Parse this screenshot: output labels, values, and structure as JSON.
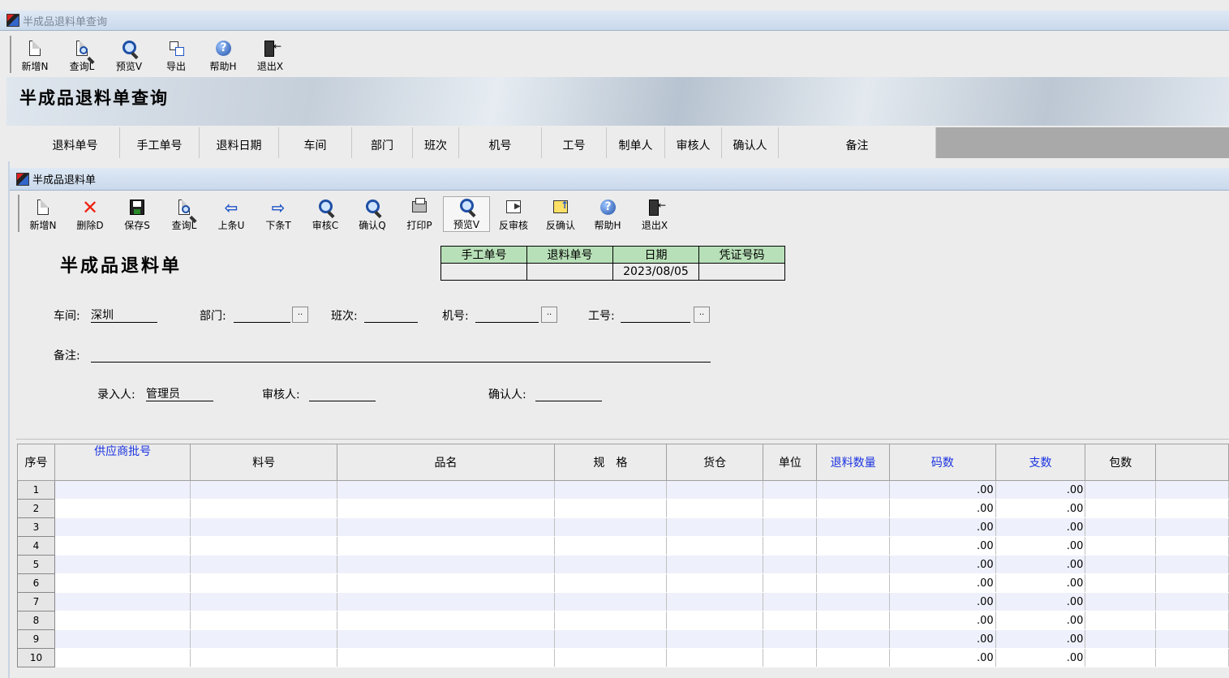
{
  "outer_window": {
    "title": "半成品退料单查询"
  },
  "outer_toolbar": [
    {
      "label": "新增N",
      "icon": "new-doc-icon",
      "kind": "doc"
    },
    {
      "label": "查询L",
      "icon": "query-icon",
      "kind": "docmag"
    },
    {
      "label": "预览V",
      "icon": "preview-icon",
      "kind": "mag"
    },
    {
      "label": "导出",
      "icon": "export-icon",
      "kind": "export"
    },
    {
      "label": "帮助H",
      "icon": "help-icon",
      "kind": "help"
    },
    {
      "label": "退出X",
      "icon": "exit-icon",
      "kind": "exit"
    }
  ],
  "banner": {
    "title": "半成品退料单查询"
  },
  "query_columns": [
    {
      "label": "退料单号",
      "w": 110
    },
    {
      "label": "手工单号",
      "w": 98
    },
    {
      "label": "退料日期",
      "w": 98
    },
    {
      "label": "车间",
      "w": 90
    },
    {
      "label": "部门",
      "w": 75
    },
    {
      "label": "班次",
      "w": 57
    },
    {
      "label": "机号",
      "w": 102
    },
    {
      "label": "工号",
      "w": 80
    },
    {
      "label": "制单人",
      "w": 72
    },
    {
      "label": "审核人",
      "w": 70
    },
    {
      "label": "确认人",
      "w": 70
    },
    {
      "label": "备注",
      "w": 194
    }
  ],
  "inner_window": {
    "title": "半成品退料单"
  },
  "inner_toolbar": [
    {
      "label": "新增N",
      "icon": "new-doc-icon",
      "kind": "doc"
    },
    {
      "label": "删除D",
      "icon": "delete-icon",
      "kind": "x"
    },
    {
      "label": "保存S",
      "icon": "save-icon",
      "kind": "save"
    },
    {
      "label": "查询L",
      "icon": "query-icon",
      "kind": "docmag"
    },
    {
      "label": "上条U",
      "icon": "prev-arrow-icon",
      "kind": "left"
    },
    {
      "label": "下条T",
      "icon": "next-arrow-icon",
      "kind": "right"
    },
    {
      "label": "审核C",
      "icon": "audit-icon",
      "kind": "mag"
    },
    {
      "label": "确认Q",
      "icon": "confirm-icon",
      "kind": "mag"
    },
    {
      "label": "打印P",
      "icon": "print-icon",
      "kind": "print"
    },
    {
      "label": "预览V",
      "icon": "preview-icon",
      "kind": "mag",
      "selected": true
    },
    {
      "label": "反审核",
      "icon": "unaudit-icon",
      "kind": "rev"
    },
    {
      "label": "反确认",
      "icon": "unconfirm-icon",
      "kind": "conf"
    },
    {
      "label": "帮助H",
      "icon": "help-icon",
      "kind": "help"
    },
    {
      "label": "退出X",
      "icon": "exit-icon",
      "kind": "exit"
    }
  ],
  "form": {
    "title": "半成品退料单",
    "header_table": {
      "headers": [
        "手工单号",
        "退料单号",
        "日期",
        "凭证号码"
      ],
      "values": [
        "",
        "",
        "2023/08/05",
        ""
      ]
    },
    "workshop_label": "车间:",
    "workshop_value": "深圳",
    "dept_label": "部门:",
    "dept_value": "",
    "shift_label": "班次:",
    "shift_value": "",
    "machine_label": "机号:",
    "machine_value": "",
    "worker_label": "工号:",
    "worker_value": "",
    "remark_label": "备注:",
    "remark_value": "",
    "creator_label": "录入人:",
    "creator_value": "管理员",
    "auditor_label": "审核人:",
    "auditor_value": "",
    "confirmer_label": "确认人:",
    "confirmer_value": ""
  },
  "grid": {
    "columns": [
      {
        "label": "序号",
        "w": 46,
        "blue": false
      },
      {
        "label": "供应商批号",
        "w": 168,
        "blue": true
      },
      {
        "label": "料号",
        "w": 181,
        "blue": false
      },
      {
        "label": "品名",
        "w": 269,
        "blue": false
      },
      {
        "label": "规　格",
        "w": 138,
        "blue": false
      },
      {
        "label": "货仓",
        "w": 120,
        "blue": false
      },
      {
        "label": "单位",
        "w": 66,
        "blue": false
      },
      {
        "label": "退料数量",
        "w": 90,
        "blue": true
      },
      {
        "label": "码数",
        "w": 131,
        "blue": true
      },
      {
        "label": "支数",
        "w": 111,
        "blue": true
      },
      {
        "label": "包数",
        "w": 87,
        "blue": false
      },
      {
        "label": "",
        "w": 90,
        "blue": false
      }
    ],
    "rows": [
      {
        "no": "1",
        "ma": ".00",
        "zhi": ".00"
      },
      {
        "no": "2",
        "ma": ".00",
        "zhi": ".00"
      },
      {
        "no": "3",
        "ma": ".00",
        "zhi": ".00"
      },
      {
        "no": "4",
        "ma": ".00",
        "zhi": ".00"
      },
      {
        "no": "5",
        "ma": ".00",
        "zhi": ".00"
      },
      {
        "no": "6",
        "ma": ".00",
        "zhi": ".00"
      },
      {
        "no": "7",
        "ma": ".00",
        "zhi": ".00"
      },
      {
        "no": "8",
        "ma": ".00",
        "zhi": ".00"
      },
      {
        "no": "9",
        "ma": ".00",
        "zhi": ".00"
      },
      {
        "no": "10",
        "ma": ".00",
        "zhi": ".00"
      }
    ]
  }
}
